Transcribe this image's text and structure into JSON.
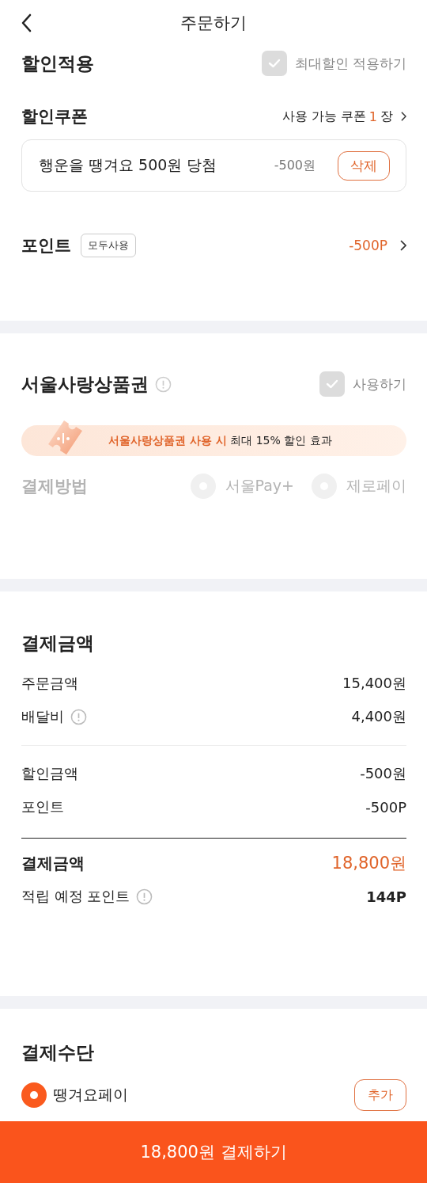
{
  "header": {
    "title": "주문하기"
  },
  "discount": {
    "title": "할인적용",
    "max_toggle": {
      "label": "최대할인 적용하기",
      "checked": true,
      "disabled": true
    },
    "coupon": {
      "title": "할인쿠폰",
      "available_prefix": "사용 가능 쿠폰",
      "available_count": "1",
      "available_suffix": "장",
      "item": {
        "name": "행운을 땡겨요 500원 당첨",
        "amount": "-500원",
        "remove": "삭제"
      }
    },
    "point": {
      "title": "포인트",
      "use_all": "모두사용",
      "amount": "-500P"
    }
  },
  "voucher": {
    "title": "서울사랑상품권",
    "use_toggle": {
      "label": "사용하기",
      "checked": true,
      "disabled": true
    },
    "banner": "**서울사랑상품권 사용 시** 최대 15% 할인 효과",
    "method": {
      "title": "결제방법",
      "disabled": true,
      "options": [
        {
          "label": "서울Pay+",
          "selected": false
        },
        {
          "label": "제로페이",
          "selected": false
        }
      ]
    }
  },
  "summary": {
    "title": "결제금액",
    "charges": [
      {
        "label": "주문금액",
        "value": "15,400원",
        "info": false
      },
      {
        "label": "배달비",
        "value": "4,400원",
        "info": true
      }
    ],
    "deductions": [
      {
        "label": "할인금액",
        "value": "-500원",
        "info": false
      },
      {
        "label": "포인트",
        "value": "-500P",
        "info": false
      }
    ],
    "total": {
      "label": "결제금액",
      "value": "18,800원"
    },
    "earn": {
      "label": "적립 예정 포인트",
      "value": "144P",
      "info": true
    }
  },
  "payment": {
    "title": "결제수단",
    "options": [
      {
        "label": "땡겨요페이",
        "selected": true
      }
    ],
    "add": "추가"
  },
  "pay_button": "18,800원 결제하기"
}
